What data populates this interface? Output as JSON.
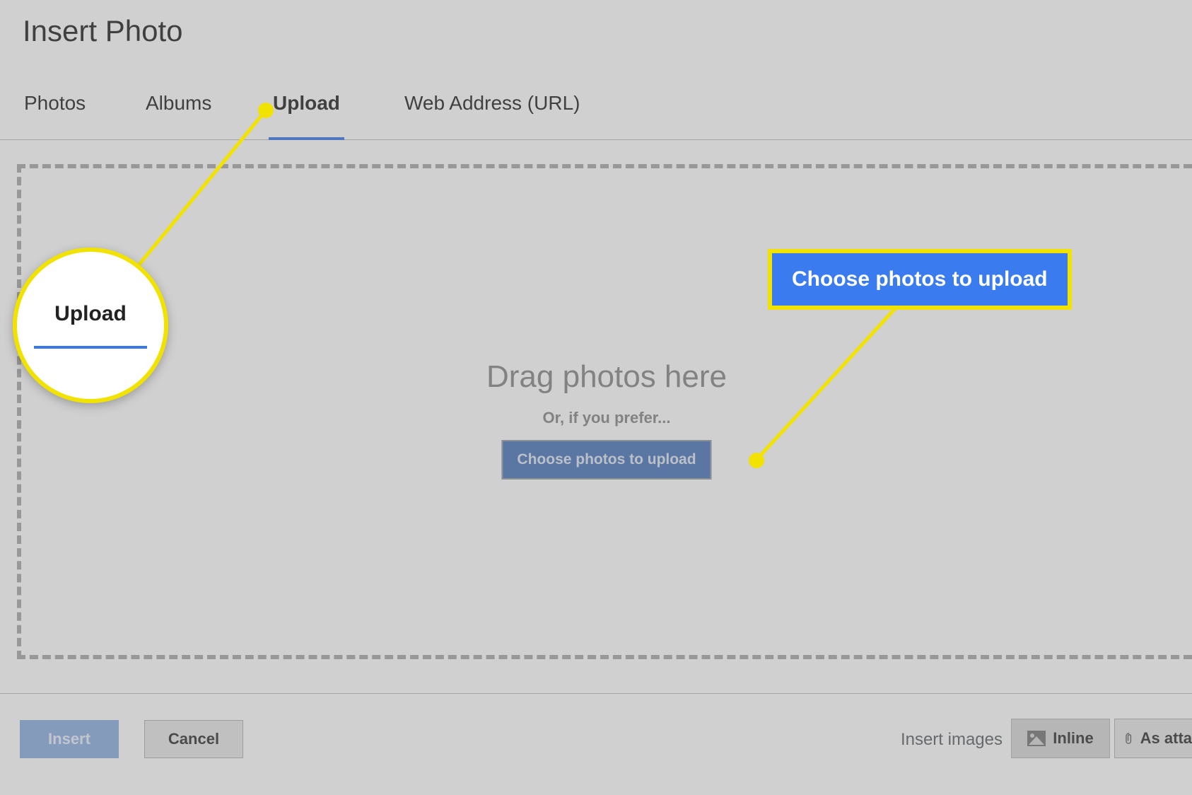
{
  "dialog": {
    "title": "Insert Photo"
  },
  "tabs": {
    "photos": "Photos",
    "albums": "Albums",
    "upload": "Upload",
    "weburl": "Web Address (URL)"
  },
  "dropzone": {
    "drag_msg": "Drag photos here",
    "prefer_msg": "Or, if you prefer...",
    "choose_btn": "Choose photos to upload"
  },
  "footer": {
    "insert": "Insert",
    "cancel": "Cancel",
    "insert_images_label": "Insert images",
    "inline": "Inline",
    "as_attachment": "As atta"
  },
  "callouts": {
    "upload_label": "Upload",
    "choose_label": "Choose photos to upload"
  }
}
